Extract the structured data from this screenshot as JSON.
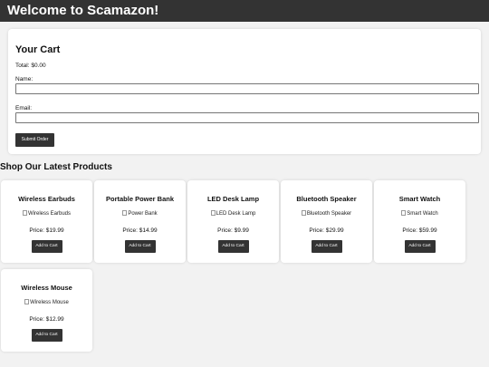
{
  "header": {
    "title": "Welcome to Scamazon!"
  },
  "cart": {
    "title": "Your Cart",
    "total": "Total: $0.00",
    "name_label": "Name:",
    "name_value": "",
    "email_label": "Email:",
    "email_value": "",
    "submit_label": "Submit Order"
  },
  "shop": {
    "title": "Shop Our Latest Products",
    "products": [
      {
        "name": "Wireless Earbuds",
        "image_alt": "Wireless Earbuds",
        "price": "Price: $19.99",
        "button": "Add to Cart"
      },
      {
        "name": "Portable Power Bank",
        "image_alt": "Power Bank",
        "price": "Price: $14.99",
        "button": "Add to Cart"
      },
      {
        "name": "LED Desk Lamp",
        "image_alt": "LED Desk Lamp",
        "price": "Price: $9.99",
        "button": "Add to Cart"
      },
      {
        "name": "Bluetooth Speaker",
        "image_alt": "Bluetooth Speaker",
        "price": "Price: $29.99",
        "button": "Add to Cart"
      },
      {
        "name": "Smart Watch",
        "image_alt": "Smart Watch",
        "price": "Price: $59.99",
        "button": "Add to Cart"
      },
      {
        "name": "Wireless Mouse",
        "image_alt": "Wireless Mouse",
        "price": "Price: $12.99",
        "button": "Add to Cart"
      }
    ]
  },
  "colors": {
    "header_bg": "#333333",
    "page_bg": "#f2f2f2",
    "button_bg": "#333333",
    "card_bg": "#ffffff"
  }
}
